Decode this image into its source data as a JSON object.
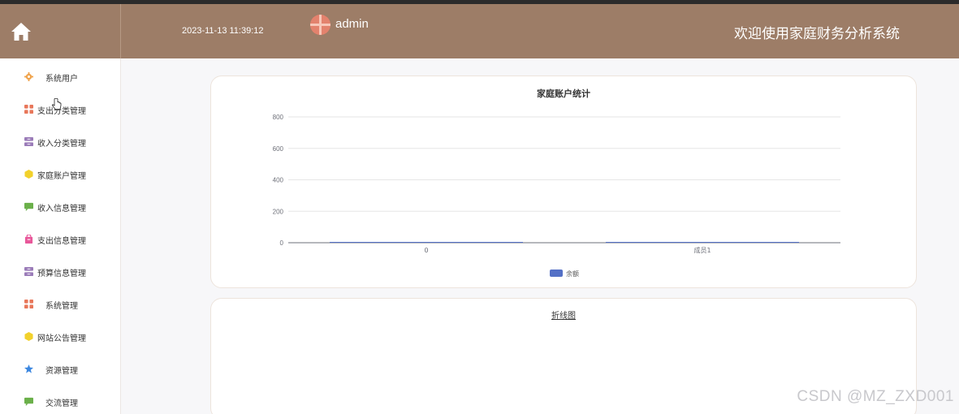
{
  "header": {
    "datetime": "2023-11-13 11:39:12",
    "username": "admin",
    "title": "欢迎使用家庭财务分析系统"
  },
  "sidebar": {
    "items": [
      {
        "label": "系统用户",
        "icon": "gear-icon",
        "color": "#f0a24a"
      },
      {
        "label": "支出分类管理",
        "icon": "grid-icon",
        "color": "#e8775a"
      },
      {
        "label": "收入分类管理",
        "icon": "archive-icon",
        "color": "#9a7bb8"
      },
      {
        "label": "家庭账户管理",
        "icon": "hexagon-icon",
        "color": "#f2d12b"
      },
      {
        "label": "收入信息管理",
        "icon": "message-icon",
        "color": "#6bb04a"
      },
      {
        "label": "支出信息管理",
        "icon": "bag-icon",
        "color": "#e8579a"
      },
      {
        "label": "预算信息管理",
        "icon": "archive-icon",
        "color": "#9a7bb8"
      },
      {
        "label": "系统管理",
        "icon": "grid-icon",
        "color": "#e8775a"
      },
      {
        "label": "网站公告管理",
        "icon": "hexagon-icon",
        "color": "#f2d12b"
      },
      {
        "label": "资源管理",
        "icon": "star-icon",
        "color": "#3c87e0"
      },
      {
        "label": "交流管理",
        "icon": "message-icon",
        "color": "#6bb04a"
      }
    ]
  },
  "chart_data": {
    "type": "bar",
    "title": "家庭账户统计",
    "categories": [
      "0",
      "成员1"
    ],
    "series": [
      {
        "name": "余额",
        "values": [
          0,
          0
        ],
        "color": "#5470c6"
      }
    ],
    "yticks": [
      "0",
      "200",
      "400",
      "600",
      "800"
    ],
    "ylim": [
      0,
      800
    ],
    "grid": true,
    "legend": "bottom-center"
  },
  "line_chart": {
    "title": "折线图"
  },
  "watermark": "CSDN @MZ_ZXD001"
}
